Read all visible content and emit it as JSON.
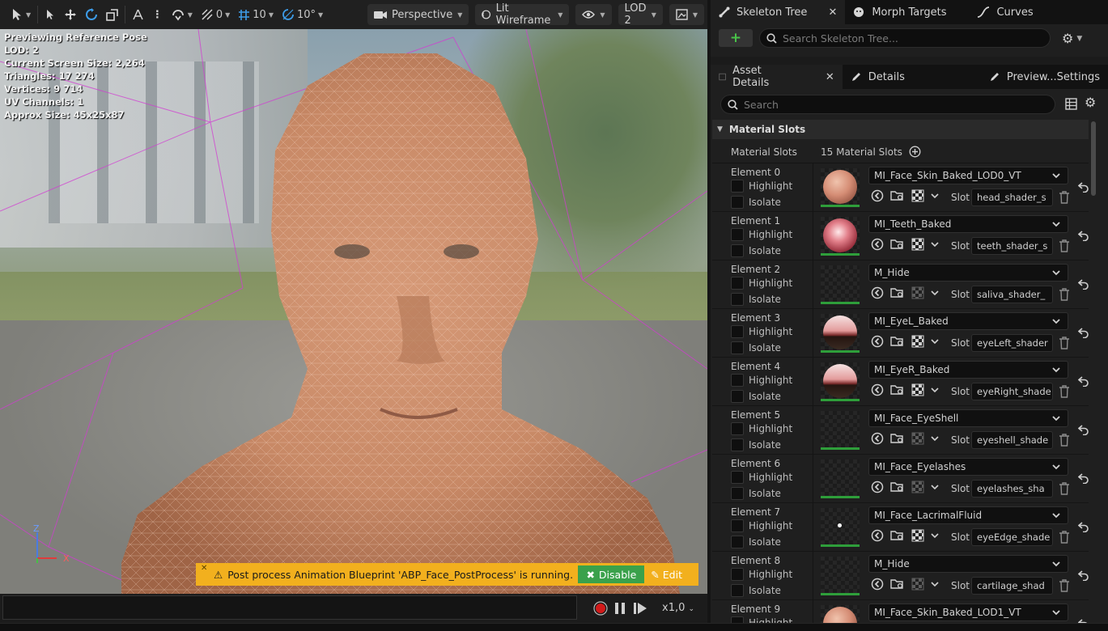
{
  "toolbar": {
    "grid_snap": "10",
    "angle_snap": "10°",
    "scale_snap": "0",
    "view_mode": "Perspective",
    "lighting_mode": "Lit Wireframe",
    "lod": "LOD 2"
  },
  "viewport_stats": {
    "line1": "Previewing Reference Pose",
    "line2": "LOD: 2",
    "line3": "Current Screen Size: 2,264",
    "line4": "Triangles: 17 274",
    "line5": "Vertices: 9 714",
    "line6": "UV Channels: 1",
    "line7": "Approx Size: 45x25x87"
  },
  "axis": {
    "z": "Z",
    "x": "X"
  },
  "notification": {
    "message": "Post process Animation Blueprint 'ABP_Face_PostProcess' is running.",
    "disable_label": "Disable",
    "edit_label": "Edit"
  },
  "playback": {
    "speed": "x1,0"
  },
  "tabs_top": [
    {
      "label": "Skeleton Tree"
    },
    {
      "label": "Morph Targets"
    },
    {
      "label": "Curves"
    }
  ],
  "skeleton_search": {
    "placeholder": "Search Skeleton Tree..."
  },
  "tabs_details": [
    {
      "label": "Asset Details"
    },
    {
      "label": "Details"
    },
    {
      "label": "Preview...Settings"
    }
  ],
  "details_search": {
    "placeholder": "Search"
  },
  "section": {
    "title": "Material Slots",
    "row_label": "Material Slots",
    "row_value": "15 Material Slots"
  },
  "labels": {
    "highlight": "Highlight",
    "isolate": "Isolate",
    "slot": "Slot"
  },
  "elements": [
    {
      "name": "Element 0",
      "material": "MI_Face_Skin_Baked_LOD0_VT",
      "slot": "head_shader_s",
      "thumb": "skin"
    },
    {
      "name": "Element 1",
      "material": "MI_Teeth_Baked",
      "slot": "teeth_shader_s",
      "thumb": "teeth"
    },
    {
      "name": "Element 2",
      "material": "M_Hide",
      "slot": "saliva_shader_",
      "thumb": "none"
    },
    {
      "name": "Element 3",
      "material": "MI_EyeL_Baked",
      "slot": "eyeLeft_shader",
      "thumb": "eye"
    },
    {
      "name": "Element 4",
      "material": "MI_EyeR_Baked",
      "slot": "eyeRight_shade",
      "thumb": "eye"
    },
    {
      "name": "Element 5",
      "material": "MI_Face_EyeShell",
      "slot": "eyeshell_shade",
      "thumb": "none"
    },
    {
      "name": "Element 6",
      "material": "MI_Face_Eyelashes",
      "slot": "eyelashes_sha",
      "thumb": "none"
    },
    {
      "name": "Element 7",
      "material": "MI_Face_LacrimalFluid",
      "slot": "eyeEdge_shade",
      "thumb": "dot"
    },
    {
      "name": "Element 8",
      "material": "M_Hide",
      "slot": "cartilage_shad",
      "thumb": "none"
    },
    {
      "name": "Element 9",
      "material": "MI_Face_Skin_Baked_LOD1_VT",
      "slot": "",
      "thumb": "skin"
    }
  ],
  "colors": {
    "accent_green": "#3aa14b",
    "warning_bg": "#f2b01e",
    "record_red": "#d11a1a",
    "wire_magenta": "#d23cd2"
  }
}
